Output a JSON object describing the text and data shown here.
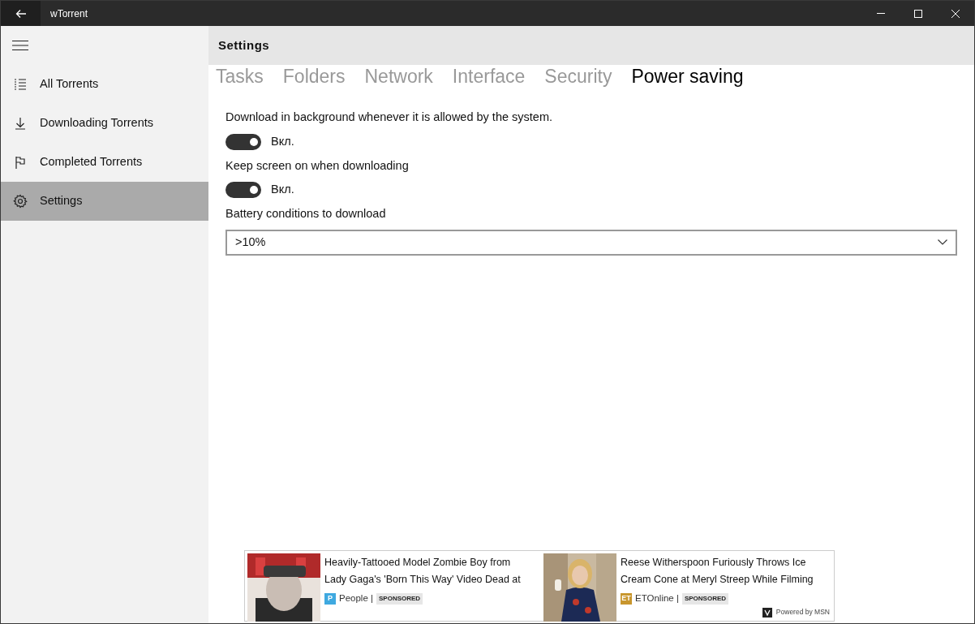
{
  "window": {
    "title": "wTorrent"
  },
  "sidebar": {
    "items": [
      {
        "label": "All Torrents",
        "selected": false
      },
      {
        "label": "Downloading Torrents",
        "selected": false
      },
      {
        "label": "Completed Torrents",
        "selected": false
      },
      {
        "label": "Settings",
        "selected": true
      }
    ]
  },
  "header": {
    "title": "Settings"
  },
  "tabs": [
    {
      "label": "Tasks",
      "selected": false
    },
    {
      "label": "Folders",
      "selected": false
    },
    {
      "label": "Network",
      "selected": false
    },
    {
      "label": "Interface",
      "selected": false
    },
    {
      "label": "Security",
      "selected": false
    },
    {
      "label": "Power saving",
      "selected": true
    }
  ],
  "settings": [
    {
      "kind": "toggle",
      "label": "Download in background whenever it is allowed by the system.",
      "on": true,
      "state_text": "Вкл."
    },
    {
      "kind": "toggle",
      "label": "Keep screen on when downloading",
      "on": true,
      "state_text": "Вкл."
    },
    {
      "kind": "dropdown",
      "label": "Battery conditions to download",
      "value": ">10%"
    }
  ],
  "ads": {
    "items": [
      {
        "title_lines": [
          "Heavily-Tattooed Model Zombie Boy from",
          "Lady Gaga's 'Born This Way' Video Dead at"
        ],
        "logo_text": "P",
        "color": "#3fa9e0",
        "source": "People |",
        "badge": "SPONSORED"
      },
      {
        "title_lines": [
          "Reese Witherspoon Furiously Throws Ice",
          "Cream Cone at Meryl Streep While Filming"
        ],
        "logo_text": "ET",
        "color": "#c8962e",
        "source": "ETOnline |",
        "badge": "SPONSORED"
      }
    ],
    "powered_by": "Powered by MSN"
  }
}
